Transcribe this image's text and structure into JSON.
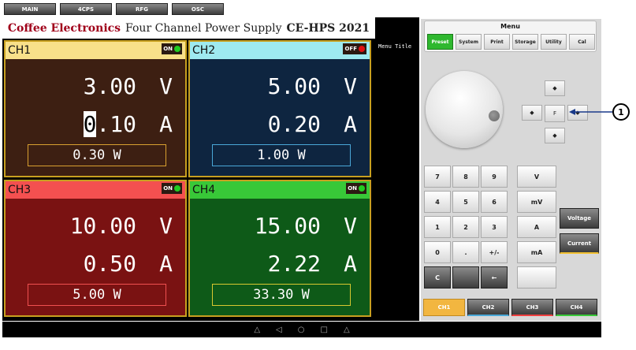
{
  "top_tabs": [
    "MAIN",
    "4CPS",
    "RFG",
    "OSC"
  ],
  "title": {
    "brand": "Coffee Electronics",
    "mid": "Four Channel Power Supply",
    "model": "CE-HPS 2021"
  },
  "menu_title_label": "Menu Title",
  "channels": [
    {
      "name": "CH1",
      "state": "ON",
      "voltage": "3.00",
      "voltage_unit": "V",
      "current_cursor": "0",
      "current_rest": ".10",
      "current_unit": "A",
      "power": "0.30 W",
      "colors": {
        "header": "#f8e08a",
        "body": "#3d1f12",
        "border": "#c8a020",
        "pwr_border": "#d8a030",
        "dot": "#22cc22"
      }
    },
    {
      "name": "CH2",
      "state": "OFF",
      "voltage": "5.00",
      "voltage_unit": "V",
      "current_cursor": "",
      "current_rest": "0.20",
      "current_unit": "A",
      "power": "1.00 W",
      "colors": {
        "header": "#9eeaf0",
        "body": "#0e2540",
        "border": "#c8a020",
        "pwr_border": "#4aa8d8",
        "dot": "#e01010"
      }
    },
    {
      "name": "CH3",
      "state": "ON",
      "voltage": "10.00",
      "voltage_unit": "V",
      "current_cursor": "",
      "current_rest": "0.50",
      "current_unit": "A",
      "power": "5.00 W",
      "colors": {
        "header": "#f45050",
        "body": "#7a1212",
        "border": "#c8a020",
        "pwr_border": "#f05050",
        "dot": "#22cc22"
      }
    },
    {
      "name": "CH4",
      "state": "ON",
      "voltage": "15.00",
      "voltage_unit": "V",
      "current_cursor": "",
      "current_rest": "2.22",
      "current_unit": "A",
      "power": "33.30 W",
      "colors": {
        "header": "#38c838",
        "body": "#0e5a18",
        "border": "#c8a020",
        "pwr_border": "#d8c830",
        "dot": "#22cc22"
      }
    }
  ],
  "menu": {
    "title": "Menu",
    "buttons": [
      "Preset",
      "System",
      "Print",
      "Storage",
      "Utility",
      "Cal"
    ],
    "active": "Preset"
  },
  "dpad": {
    "up": "◆",
    "left": "◆",
    "center": "F",
    "right": "◆",
    "down": "◆"
  },
  "keypad": {
    "keys": [
      "7",
      "8",
      "9",
      "4",
      "5",
      "6",
      "1",
      "2",
      "3",
      "0",
      ".",
      "+/-",
      "C",
      "",
      "←"
    ],
    "units": [
      "V",
      "mV",
      "A",
      "mA",
      ""
    ]
  },
  "mode_buttons": [
    "Voltage",
    "Current"
  ],
  "channel_select": [
    "CH1",
    "CH2",
    "CH3",
    "CH4"
  ],
  "channel_select_active": "CH1",
  "nav_icons": [
    "volume-down-icon",
    "back-icon",
    "home-icon",
    "recents-icon",
    "volume-up-icon"
  ],
  "callout_number": "1"
}
